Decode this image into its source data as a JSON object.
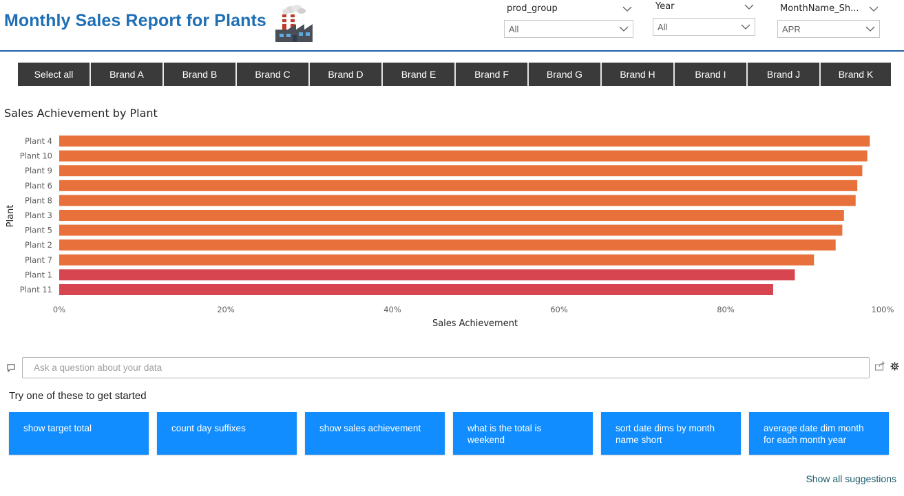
{
  "header": {
    "title": "Monthly Sales Report for Plants",
    "logo_icon": "factory-icon"
  },
  "slicers": [
    {
      "title": "prod_group",
      "value": "All"
    },
    {
      "title": "Year",
      "value": "All"
    },
    {
      "title": "MonthName_Sh...",
      "value": "APR"
    }
  ],
  "brands": [
    "Select all",
    "Brand A",
    "Brand B",
    "Brand C",
    "Brand D",
    "Brand E",
    "Brand F",
    "Brand G",
    "Brand H",
    "Brand I",
    "Brand J",
    "Brand K"
  ],
  "chart_title": "Sales Achievement by Plant",
  "chart_data": {
    "type": "bar",
    "orientation": "horizontal",
    "title": "Sales Achievement by Plant",
    "xlabel": "Sales Achievement",
    "ylabel": "Plant",
    "xlim": [
      0,
      1
    ],
    "x_ticks": [
      "0%",
      "20%",
      "40%",
      "60%",
      "80%",
      "100%"
    ],
    "categories": [
      "Plant 4",
      "Plant 10",
      "Plant 9",
      "Plant 6",
      "Plant 8",
      "Plant 3",
      "Plant 5",
      "Plant 2",
      "Plant 7",
      "Plant 1",
      "Plant 11"
    ],
    "values": [
      0.973,
      0.97,
      0.964,
      0.958,
      0.956,
      0.942,
      0.94,
      0.932,
      0.906,
      0.883,
      0.857
    ],
    "colors": [
      "#e8703a",
      "#e8703a",
      "#e8703a",
      "#e8703a",
      "#e8703a",
      "#e8703a",
      "#e8703a",
      "#e8703a",
      "#e8703a",
      "#d64550",
      "#d64550"
    ],
    "grid": false
  },
  "qa": {
    "placeholder": "Ask a question about your data",
    "try_label": "Try one of these to get started",
    "suggestions": [
      "show target total",
      "count day suffixes",
      "show sales achievement",
      "what is the total is weekend",
      "sort date dims by month name short",
      "average date dim month for each month year"
    ],
    "show_all": "Show all suggestions"
  },
  "colors": {
    "title": "#1f6fb5",
    "button_bg": "#3a3a3a",
    "suggestion_bg": "#118dff",
    "bar_primary": "#e8703a",
    "bar_low": "#d64550"
  }
}
